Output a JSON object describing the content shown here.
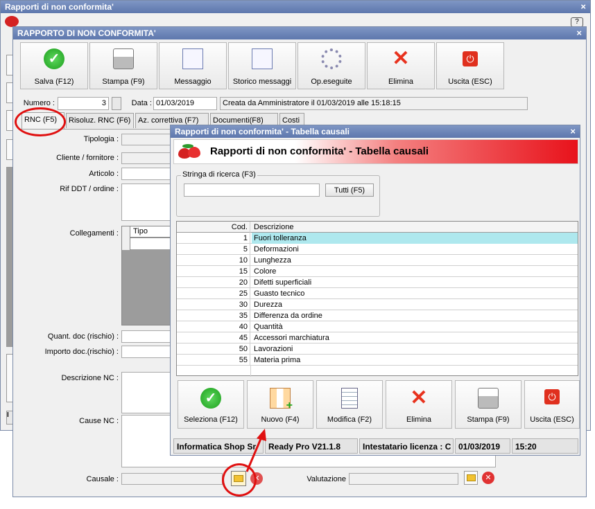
{
  "bg_window": {
    "title": "Rapporti di non conformita'"
  },
  "main_window": {
    "title": "RAPPORTO DI NON CONFORMITA'",
    "toolbar": [
      "Salva (F12)",
      "Stampa (F9)",
      "Messaggio",
      "Storico messaggi",
      "Op.eseguite",
      "Elimina",
      "Uscita (ESC)"
    ],
    "numero_label": "Numero :",
    "numero_value": "3",
    "data_label": "Data :",
    "data_value": "01/03/2019",
    "created_info": "Creata da Amministratore il 01/03/2019 alle 15:18:15",
    "tabs": [
      "RNC (F5)",
      "Risoluz. RNC (F6)",
      "Az. correttiva (F7)",
      "Documenti(F8)",
      "Costi"
    ],
    "labels": {
      "tipologia": "Tipologia :",
      "cliente": "Cliente / fornitore :",
      "articolo": "Articolo :",
      "rif_ddt": "Rif DDT / ordine :",
      "collegamenti": "Collegamenti :",
      "tipo_col": "Tipo",
      "quant": "Quant. doc (rischio) :",
      "importo": "Importo doc.(rischio) :",
      "descrizione": "Descrizione NC :",
      "cause": "Cause NC :",
      "causale": "Causale :",
      "valutazione": "Valutazione"
    }
  },
  "dialog": {
    "title": "Rapporti di non conformita' - Tabella causali",
    "header": "Rapporti di non conformita' - Tabella causali",
    "search_legend": "Stringa di ricerca (F3)",
    "search_value": "",
    "tutti_button": "Tutti (F5)",
    "grid_headers": [
      "Cod.",
      "Descrizione"
    ],
    "rows": [
      {
        "cod": "1",
        "desc": "Fuori tolleranza"
      },
      {
        "cod": "5",
        "desc": "Deformazioni"
      },
      {
        "cod": "10",
        "desc": "Lunghezza"
      },
      {
        "cod": "15",
        "desc": "Colore"
      },
      {
        "cod": "20",
        "desc": "Difetti superficiali"
      },
      {
        "cod": "25",
        "desc": "Guasto tecnico"
      },
      {
        "cod": "30",
        "desc": "Durezza"
      },
      {
        "cod": "35",
        "desc": "Differenza da ordine"
      },
      {
        "cod": "40",
        "desc": "Quantità"
      },
      {
        "cod": "45",
        "desc": "Accessori marchiatura"
      },
      {
        "cod": "50",
        "desc": "Lavorazioni"
      },
      {
        "cod": "55",
        "desc": "Materia prima"
      }
    ],
    "buttons": [
      "Seleziona (F12)",
      "Nuovo (F4)",
      "Modifica (F2)",
      "Elimina",
      "Stampa (F9)",
      "Uscita (ESC)"
    ],
    "status": [
      "Informatica Shop Sr",
      "Ready Pro V21.1.8",
      "Intestatario licenza : C",
      "01/03/2019",
      "15:20"
    ]
  },
  "colors": {
    "titlebar": "#6a82b8",
    "selected_row": "#aee8ee",
    "header_red": "#e8121b",
    "annotation_red": "#e01010"
  }
}
